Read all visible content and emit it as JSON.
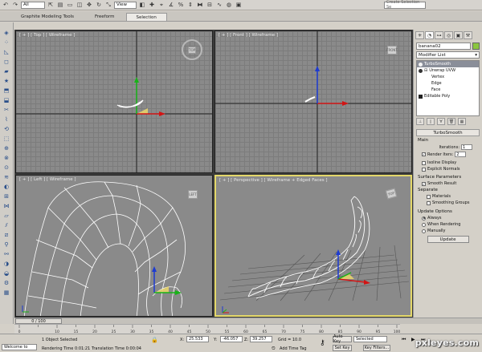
{
  "toolbar": {
    "filter_value": "All",
    "view_value": "View",
    "selection_set_placeholder": "Create Selection Se"
  },
  "ribbon": {
    "tabs": [
      {
        "label": "Graphite Modeling Tools",
        "active": false
      },
      {
        "label": "Freeform",
        "active": false
      },
      {
        "label": "Selection",
        "active": true
      }
    ]
  },
  "viewports": {
    "top": {
      "label": "[ + ] [ Top ] [ Wireframe ]"
    },
    "front": {
      "label": "[ + ] [ Front ] [ Wireframe ]"
    },
    "left": {
      "label": "[ + ] [ Left ] [ Wireframe ]"
    },
    "perspective": {
      "label": "[ + ] [ Perspective ] [ Wireframe + Edged Faces ]"
    }
  },
  "command_panel": {
    "object_name": "banana02",
    "object_color": "#8bc63e",
    "modifier_list_label": "Modifier List",
    "stack": [
      {
        "label": "TurboSmooth",
        "selected": true,
        "level": 0
      },
      {
        "label": "Unwrap UVW",
        "selected": false,
        "level": 0
      },
      {
        "label": "Vertex",
        "selected": false,
        "level": 2
      },
      {
        "label": "Edge",
        "selected": false,
        "level": 2
      },
      {
        "label": "Face",
        "selected": false,
        "level": 2
      },
      {
        "label": "Editable Poly",
        "selected": false,
        "level": 0
      }
    ],
    "turbosmooth": {
      "title": "TurboSmooth",
      "main_label": "Main",
      "iterations_label": "Iterations:",
      "iterations_value": "1",
      "render_iters_label": "Render Iters:",
      "render_iters_value": "2",
      "render_iters_checked": true,
      "isoline_label": "Isoline Display",
      "isoline_checked": false,
      "explicit_normals_label": "Explicit Normals",
      "explicit_normals_checked": false,
      "surface_params_label": "Surface Parameters",
      "smooth_result_label": "Smooth Result",
      "smooth_result_checked": true,
      "separate_label": "Separate",
      "materials_label": "Materials",
      "materials_checked": false,
      "smoothing_groups_label": "Smoothing Groups",
      "smoothing_groups_checked": false,
      "update_options_label": "Update Options",
      "always_label": "Always",
      "when_rendering_label": "When Rendering",
      "manually_label": "Manually",
      "update_mode": "always",
      "update_button": "Update"
    }
  },
  "timeline": {
    "slider_label": "0 / 100",
    "ticks": [
      "0",
      "10",
      "15",
      "20",
      "25",
      "30",
      "35",
      "40",
      "45",
      "50",
      "55",
      "60",
      "65",
      "70",
      "75",
      "80",
      "85",
      "90",
      "95",
      "100"
    ]
  },
  "status": {
    "welcome": "Welcome to",
    "objects_selected": "1 Object Selected",
    "rendering_time": "Rendering Time  0:01:21",
    "translation_time": "Translation Time  0:00:04",
    "x_label": "X:",
    "x_value": "25.533",
    "y_label": "Y:",
    "y_value": "-46.057",
    "z_label": "Z:",
    "z_value": "39.257",
    "grid": "Grid = 10.0",
    "add_time_tag": "Add Time Tag",
    "auto_key": "Auto Key",
    "set_key": "Set Key",
    "selected": "Selected",
    "key_filters": "Key Filters...",
    "watermark": "pxleyes.com"
  }
}
